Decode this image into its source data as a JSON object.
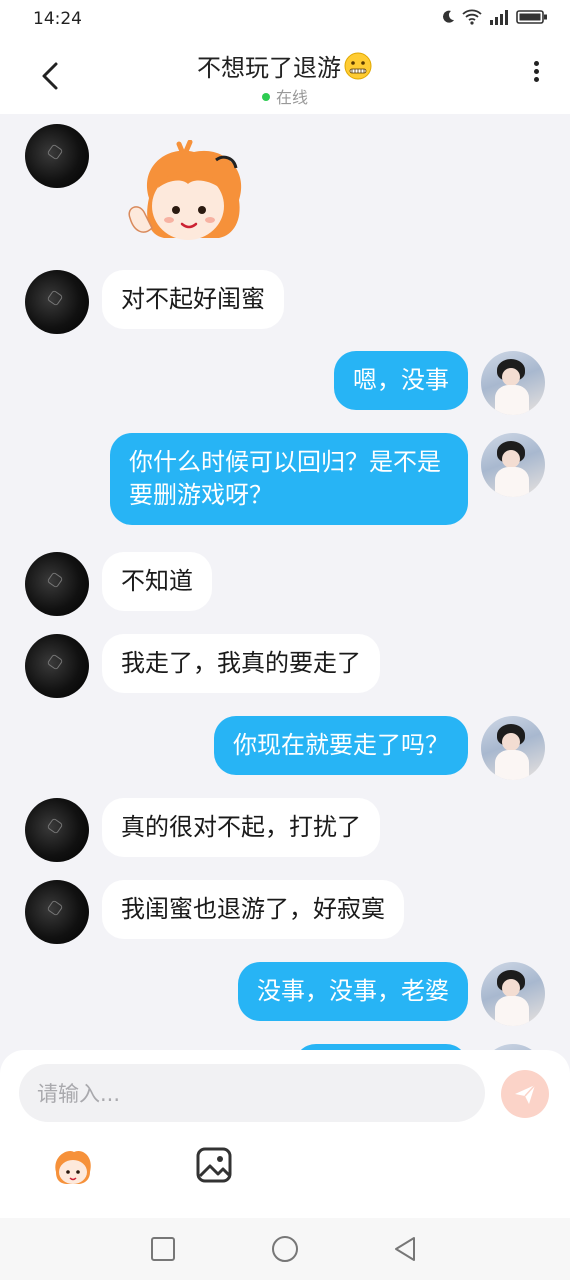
{
  "status_bar": {
    "time": "14:24"
  },
  "header": {
    "title": "不想玩了退游",
    "status": "在线"
  },
  "messages": [
    {
      "side": "in",
      "type": "sticker"
    },
    {
      "side": "in",
      "text": "对不起好闺蜜"
    },
    {
      "side": "out",
      "text": "嗯，没事"
    },
    {
      "side": "out",
      "text": "你什么时候可以回归？是不是要删游戏呀？"
    },
    {
      "side": "in",
      "text": "不知道"
    },
    {
      "side": "in",
      "text": "我走了，我真的要走了"
    },
    {
      "side": "out",
      "text": "你现在就要走了吗？"
    },
    {
      "side": "in",
      "text": "真的很对不起，打扰了"
    },
    {
      "side": "in",
      "text": "我闺蜜也退游了，好寂寞"
    },
    {
      "side": "out",
      "text": "没事，没事，老婆"
    }
  ],
  "input": {
    "placeholder": "请输入...",
    "value": ""
  },
  "colors": {
    "outgoing_bubble": "#27b4f5",
    "incoming_bubble": "#ffffff",
    "online_dot": "#2ecc52",
    "send_button": "#fbd3c8"
  }
}
